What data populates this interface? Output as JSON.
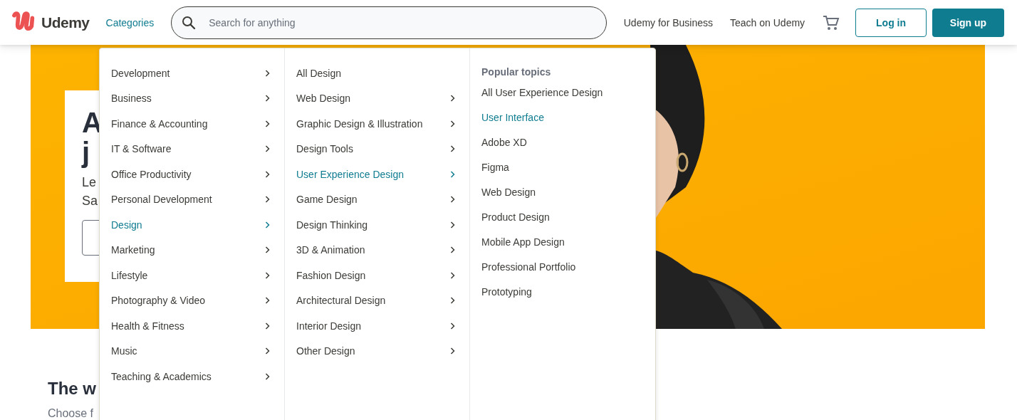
{
  "header": {
    "logo": "Udemy",
    "categories_link": "Categories",
    "search": {
      "placeholder": "Search for anything"
    },
    "links": [
      "Udemy for Business",
      "Teach on Udemy"
    ],
    "login": "Log in",
    "signup": "Sign up"
  },
  "hero": {
    "kind": "picture",
    "heading_lines": [
      "A",
      "j"
    ],
    "body_lines": [
      "Le",
      "Sa"
    ]
  },
  "section": {
    "title": "The w",
    "subtitle": "Choose f"
  },
  "menu": {
    "categories": [
      {
        "label": "Development",
        "selected": false
      },
      {
        "label": "Business",
        "selected": false
      },
      {
        "label": "Finance & Accounting",
        "selected": false
      },
      {
        "label": "IT & Software",
        "selected": false
      },
      {
        "label": "Office Productivity",
        "selected": false
      },
      {
        "label": "Personal Development",
        "selected": false
      },
      {
        "label": "Design",
        "selected": true
      },
      {
        "label": "Marketing",
        "selected": false
      },
      {
        "label": "Lifestyle",
        "selected": false
      },
      {
        "label": "Photography & Video",
        "selected": false
      },
      {
        "label": "Health & Fitness",
        "selected": false
      },
      {
        "label": "Music",
        "selected": false
      },
      {
        "label": "Teaching & Academics",
        "selected": false
      }
    ],
    "subcategories": [
      {
        "label": "All Design",
        "selected": false,
        "expandable": false
      },
      {
        "label": "Web Design",
        "selected": false,
        "expandable": true
      },
      {
        "label": "Graphic Design & Illustration",
        "selected": false,
        "expandable": true
      },
      {
        "label": "Design Tools",
        "selected": false,
        "expandable": true
      },
      {
        "label": "User Experience Design",
        "selected": true,
        "expandable": true
      },
      {
        "label": "Game Design",
        "selected": false,
        "expandable": true
      },
      {
        "label": "Design Thinking",
        "selected": false,
        "expandable": true
      },
      {
        "label": "3D & Animation",
        "selected": false,
        "expandable": true
      },
      {
        "label": "Fashion Design",
        "selected": false,
        "expandable": true
      },
      {
        "label": "Architectural Design",
        "selected": false,
        "expandable": true
      },
      {
        "label": "Interior Design",
        "selected": false,
        "expandable": true
      },
      {
        "label": "Other Design",
        "selected": false,
        "expandable": true
      }
    ],
    "popular_topics": {
      "title": "Popular topics",
      "items": [
        {
          "label": "All User Experience Design",
          "selected": false
        },
        {
          "label": "User Interface",
          "selected": true
        },
        {
          "label": "Adobe XD",
          "selected": false
        },
        {
          "label": "Figma",
          "selected": false
        },
        {
          "label": "Web Design",
          "selected": false
        },
        {
          "label": "Product Design",
          "selected": false
        },
        {
          "label": "Mobile App Design",
          "selected": false
        },
        {
          "label": "Professional Portfolio",
          "selected": false
        },
        {
          "label": "Prototyping",
          "selected": false
        }
      ]
    }
  }
}
